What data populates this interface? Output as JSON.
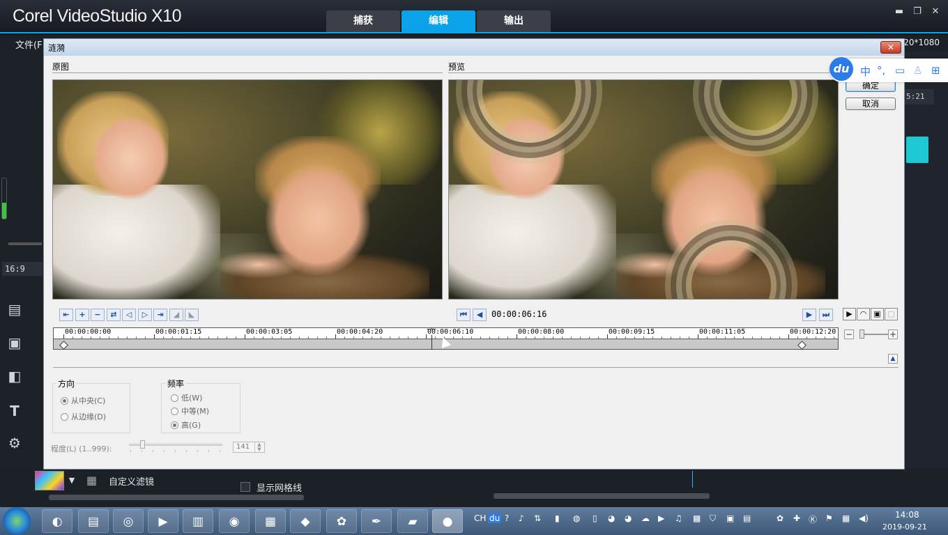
{
  "app": {
    "title": "Corel VideoStudio X10",
    "tabs": [
      "捕获",
      "编辑",
      "输出"
    ],
    "active_tab": "编辑",
    "menu_file": "文件(F",
    "resolution": "20*1080",
    "aspect_ratio": "16:9",
    "timecode_partial": "5:21",
    "bottom": {
      "custom_filter": "自定义滤镜",
      "show_grid": "显示网格线"
    }
  },
  "dialog": {
    "title": "涟漪",
    "close_label": "✕",
    "original_label": "原图",
    "preview_label": "预览",
    "ok_label": "确定",
    "cancel_label": "取消",
    "preview_timecode": "00:00:06:16",
    "timeline": {
      "ticks": [
        "00:00:00:00",
        "00:00:01:15",
        "00:00:03:05",
        "00:00:04:20",
        "00:00:06:10",
        "00:00:08:00",
        "00:00:09:15",
        "00:00:11:05",
        "00:00:12:20"
      ],
      "playhead": "00:00:06:16",
      "keyframes": [
        "00:00:00:00",
        "00:00:12:20"
      ]
    },
    "direction": {
      "title": "方向",
      "options": [
        "从中央(C)",
        "从边缘(D)"
      ],
      "selected": "从中央(C)"
    },
    "frequency": {
      "title": "频率",
      "options": [
        "低(W)",
        "中等(M)",
        "高(G)"
      ],
      "selected": "高(G)"
    },
    "degree": {
      "label": "程度(L) (1..999):",
      "value": "141"
    }
  },
  "ime": {
    "logo": "du",
    "mode": "中"
  },
  "taskbar": {
    "tray_lang": "CH",
    "time": "14:08",
    "date": "2019-09-21"
  },
  "icons": [
    "minimize-icon",
    "restore-icon",
    "close-icon",
    "go-start-icon",
    "play-icon",
    "search-icon",
    "speaker-icon"
  ]
}
